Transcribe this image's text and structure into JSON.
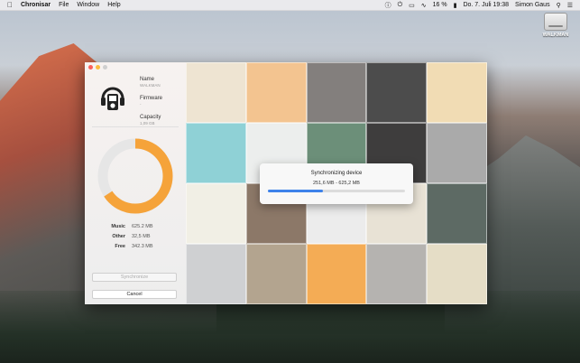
{
  "menubar": {
    "app_name": "Chronisar",
    "menus": [
      "File",
      "Window",
      "Help"
    ],
    "battery": "16 %",
    "datetime": "Do. 7. Juli  19:38",
    "user": "Simon Gaus"
  },
  "desktop": {
    "drive_label": "WALKMAN"
  },
  "device": {
    "name_label": "Name",
    "name_value": "WALKMAN",
    "firmware_label": "Firmware",
    "firmware_value": "-",
    "capacity_label": "Capacity",
    "capacity_value": "1,09 GB"
  },
  "storage": {
    "music_label": "Music",
    "music_value": "625.2 MB",
    "other_label": "Other",
    "other_value": "32,5 MB",
    "free_label": "Free",
    "free_value": "342.3 MB",
    "used_fraction": 0.657,
    "colors": {
      "music": "#f5a33a",
      "other": "#f7c85d",
      "free": "#e6e6e6"
    }
  },
  "buttons": {
    "synchronize": "Synchronize",
    "cancel": "Cancel"
  },
  "sync_dialog": {
    "title": "Synchronizing device",
    "progress_text": "251,6 MB - 625,2 MB",
    "progress_fraction": 0.4,
    "accent": "#3d82ea"
  },
  "album_tiles": [
    "#eee4d2",
    "#f3c490",
    "#837f7d",
    "#4c4c4c",
    "#f1dcb4",
    "#8fd1d6",
    "#eceeed",
    "#6c8f79",
    "#3e3d3d",
    "#aaaaaa",
    "#f1efe5",
    "#8c7868",
    "#ececec",
    "#e8e2d5",
    "#5d6a64",
    "#cfd0d2",
    "#b3a48f",
    "#f4ac55",
    "#b5b3b0",
    "#e5ddc6"
  ]
}
